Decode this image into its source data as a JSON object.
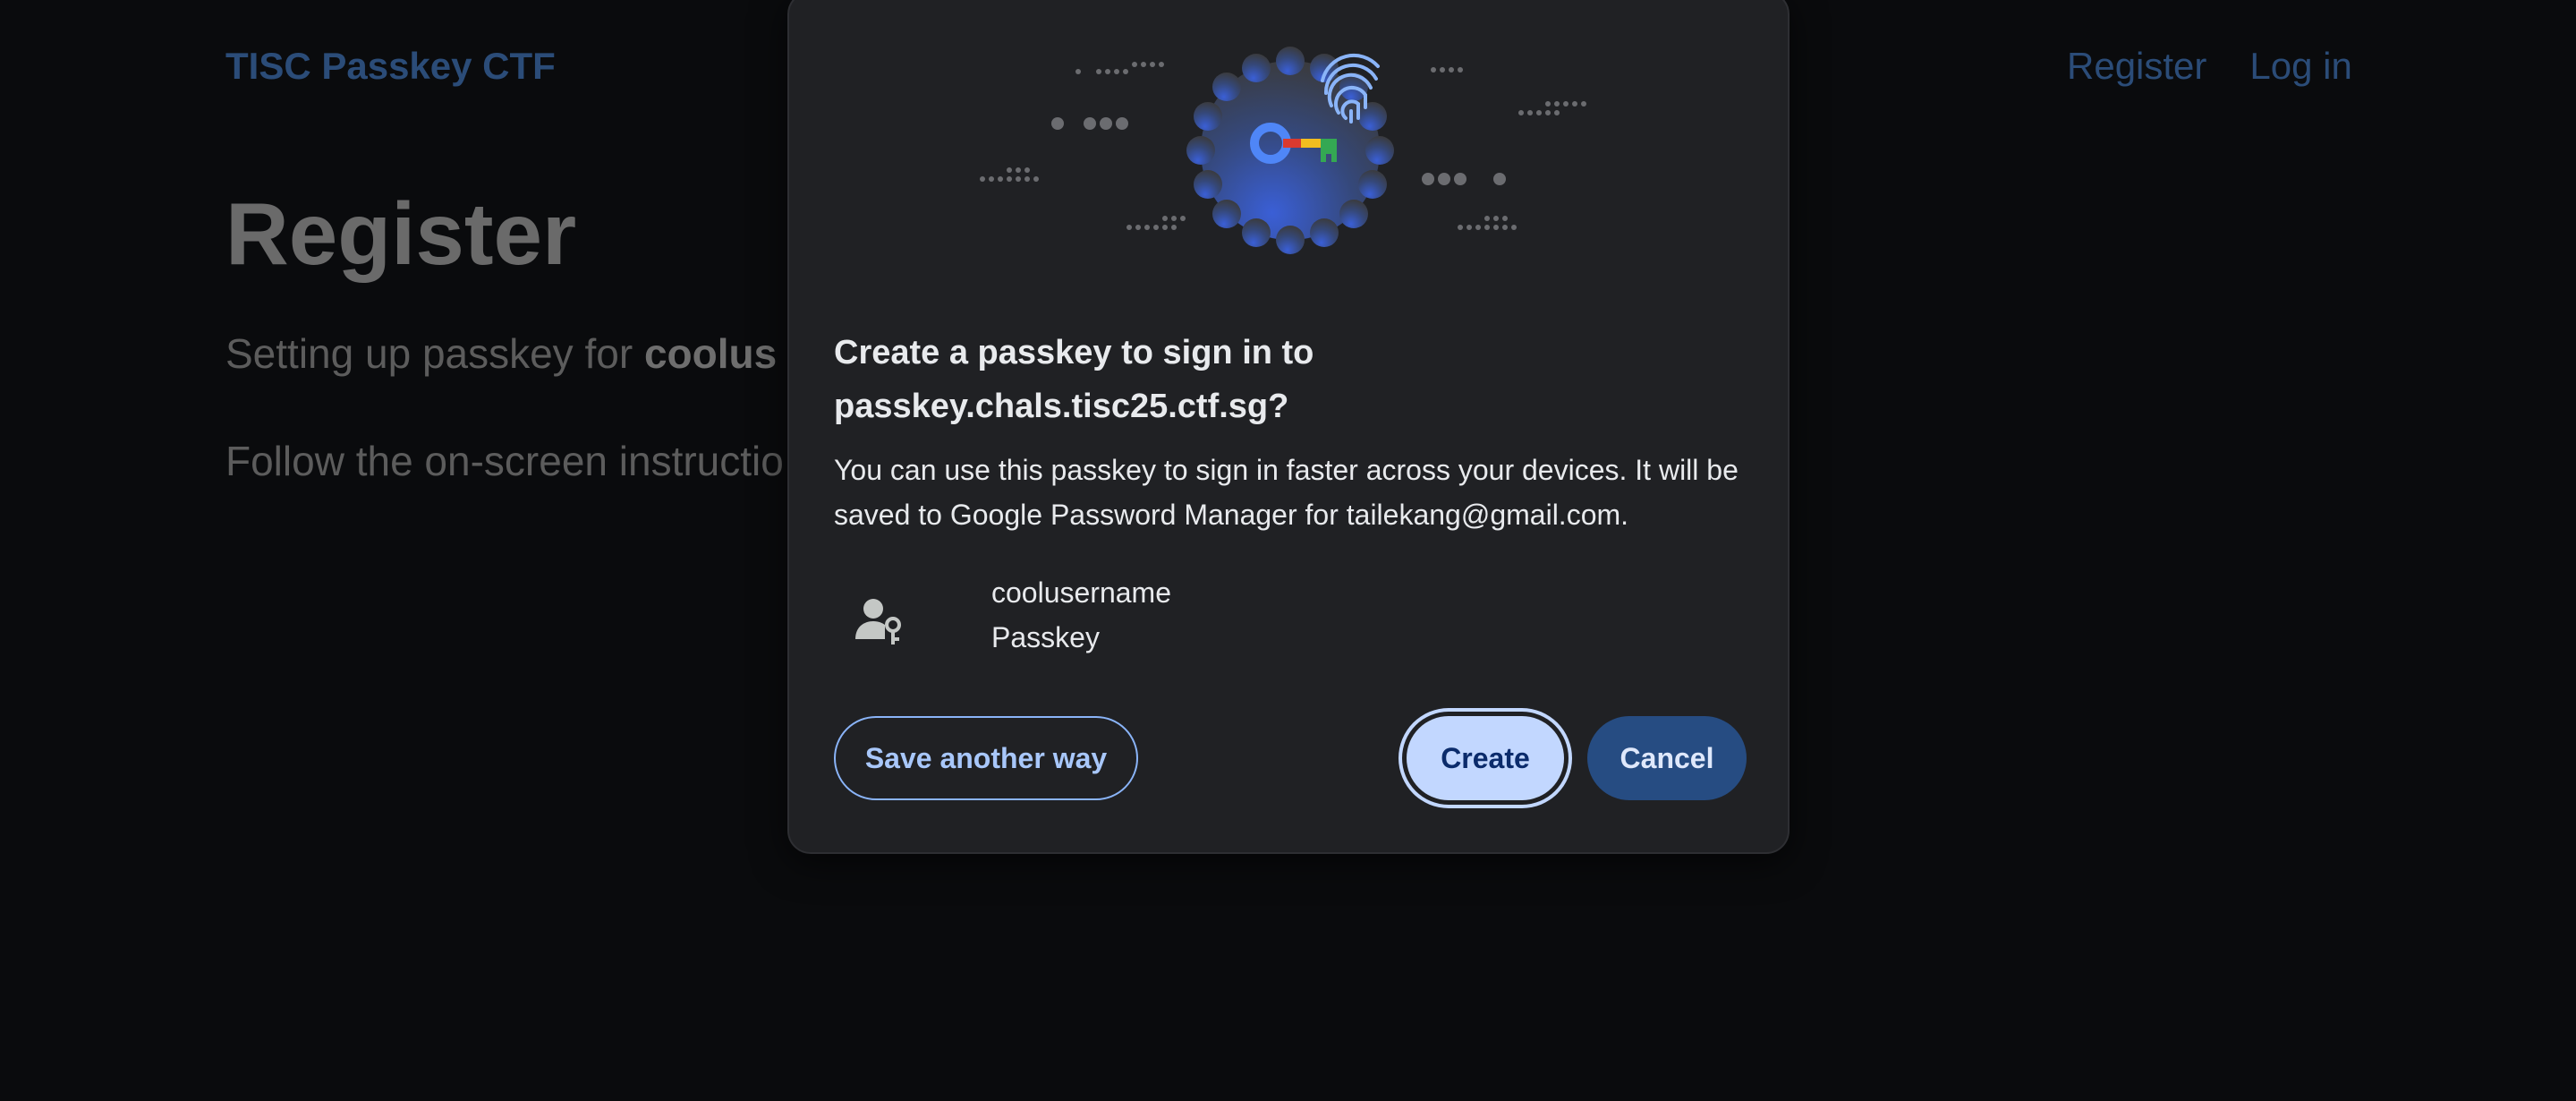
{
  "page": {
    "brand": "TISC Passkey CTF",
    "nav": {
      "register": "Register",
      "login": "Log in"
    },
    "title": "Register",
    "setup_prefix": "Setting up passkey for ",
    "setup_user": "coolus",
    "instructions": "Follow the on-screen instructio"
  },
  "dialog": {
    "title": "Create a passkey to sign in to passkey.chals.tisc25.ctf.sg?",
    "description": "You can use this passkey to sign in faster across your devices. It will be saved to Google Password Manager for tailekang@gmail.com.",
    "account": {
      "username": "coolusername",
      "type": "Passkey"
    },
    "buttons": {
      "save_another_way": "Save another way",
      "create": "Create",
      "cancel": "Cancel"
    }
  },
  "colors": {
    "accent": "#8ab4f8",
    "primary_button": "#c2d7ff",
    "secondary_button": "#264c82",
    "dialog_bg": "#202124",
    "page_bg": "#0a0b0d"
  },
  "icons": {
    "illustration": "passkey-key-fingerprint-illustration",
    "account": "person-key-icon"
  }
}
